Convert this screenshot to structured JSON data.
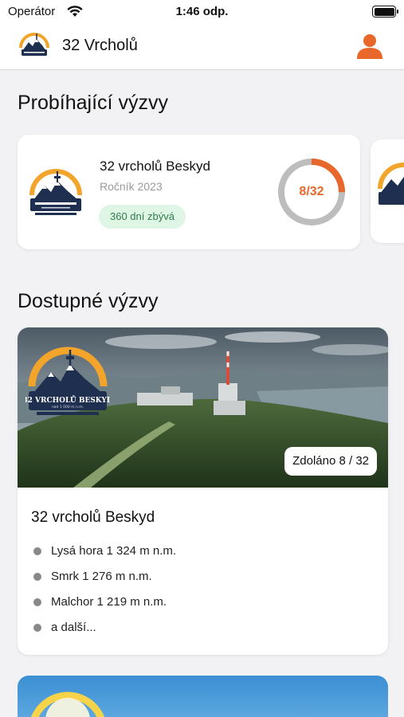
{
  "status_bar": {
    "carrier": "Operátor",
    "time": "1:46 odp."
  },
  "nav": {
    "title": "32 Vrcholů"
  },
  "sections": {
    "ongoing_title": "Probíhající výzvy",
    "available_title": "Dostupné výzvy"
  },
  "ongoing": [
    {
      "name": "32 vrcholů Beskyd",
      "year": "Ročník 2023",
      "days_left": "360 dní zbývá",
      "progress_label": "8/32",
      "progress_fraction": 0.25
    }
  ],
  "available": [
    {
      "name": "32 vrcholů Beskyd",
      "done_label": "Zdoláno 8 / 32",
      "peaks": [
        "Lysá hora 1 324 m n.m.",
        "Smrk 1 276 m n.m.",
        "Malchor 1 219 m n.m.",
        "a další..."
      ]
    }
  ],
  "logo_text": {
    "main": "32 VRCHOLŮ BESKYD",
    "sub": "nad 1 000 m n.m."
  },
  "colors": {
    "accent": "#e8682c",
    "badge_bg": "#dff5e5",
    "badge_text": "#2e7d4a",
    "ring_track": "#bdbdbd"
  },
  "icons": {
    "profile": "person-icon",
    "wifi": "wifi-icon",
    "battery": "battery-icon"
  }
}
